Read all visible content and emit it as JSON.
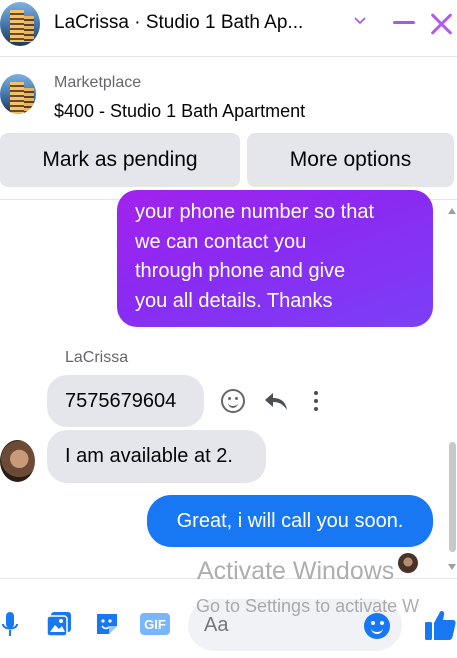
{
  "header": {
    "title": "LaCrissa · Studio 1 Bath Ap...",
    "avatar": "building-thumbnail",
    "chevron_icon": "chevron-down-icon",
    "minimize_icon": "minimize-icon",
    "close_icon": "close-icon",
    "accent_color": "#a855f7"
  },
  "listing": {
    "source": "Marketplace",
    "title": "$400 - Studio 1 Bath Apartment"
  },
  "actions": {
    "mark_pending_label": "Mark as pending",
    "more_options_label": "More options"
  },
  "messages": {
    "outgoing_1": {
      "lines": [
        "your phone number so that",
        "we can contact you",
        "through phone and give",
        "you all details. Thanks"
      ]
    },
    "sender_name": "LaCrissa",
    "incoming_1": "7575679604",
    "incoming_2": "I am available at 2.",
    "outgoing_2": "Great, i will call you soon."
  },
  "footer": {
    "input_placeholder": "Aa",
    "icons": [
      "microphone-icon",
      "photo-icon",
      "sticker-icon",
      "gif-icon",
      "emoji-icon",
      "thumbs-up-icon"
    ],
    "gif_label": "GIF",
    "brand_color": "#1877f2"
  },
  "watermark": {
    "title": "Activate Windows",
    "subtitle": "Go to Settings to activate W"
  }
}
